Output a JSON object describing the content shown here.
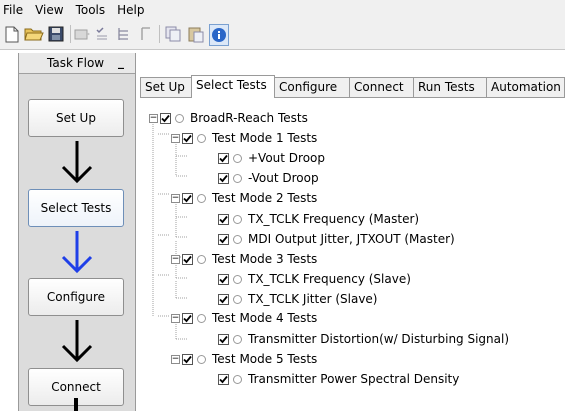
{
  "menubar": {
    "items": [
      "File",
      "View",
      "Tools",
      "Help"
    ]
  },
  "toolbar": {
    "icons": [
      "new-document-icon",
      "open-folder-icon",
      "save-icon",
      "run-icon",
      "checklist-icon",
      "tree-icon",
      "marker-icon",
      "copy-icon",
      "paste-icon",
      "info-icon"
    ]
  },
  "task_flow": {
    "title": "Task Flow",
    "minimize": "_",
    "steps": [
      "Set Up",
      "Select Tests",
      "Configure",
      "Connect"
    ],
    "active_step": "Select Tests",
    "arrow_color_active": "#1f3fe8",
    "arrow_color_default": "#000000"
  },
  "tabs": [
    "Set Up",
    "Select Tests",
    "Configure",
    "Connect",
    "Run Tests",
    "Automation"
  ],
  "selected_tab": "Select Tests",
  "tree": {
    "root": {
      "label": "BroadR-Reach Tests",
      "checked": true
    },
    "groups": [
      {
        "label": "Test Mode 1 Tests",
        "checked": true,
        "children": [
          {
            "label": "+Vout Droop",
            "checked": true
          },
          {
            "label": "-Vout Droop",
            "checked": true
          }
        ]
      },
      {
        "label": "Test Mode 2 Tests",
        "checked": true,
        "children": [
          {
            "label": "TX_TCLK Frequency (Master)",
            "checked": true
          },
          {
            "label": "MDI Output Jitter, JTXOUT (Master)",
            "checked": true
          }
        ]
      },
      {
        "label": "Test Mode 3 Tests",
        "checked": true,
        "children": [
          {
            "label": "TX_TCLK Frequency (Slave)",
            "checked": true
          },
          {
            "label": "TX_TCLK Jitter (Slave)",
            "checked": true
          }
        ]
      },
      {
        "label": "Test Mode 4 Tests",
        "checked": true,
        "children": [
          {
            "label": "Transmitter Distortion(w/ Disturbing Signal)",
            "checked": true
          }
        ]
      },
      {
        "label": "Test Mode 5 Tests",
        "checked": true,
        "children": [
          {
            "label": "Transmitter Power Spectral Density",
            "checked": true
          }
        ]
      }
    ]
  }
}
